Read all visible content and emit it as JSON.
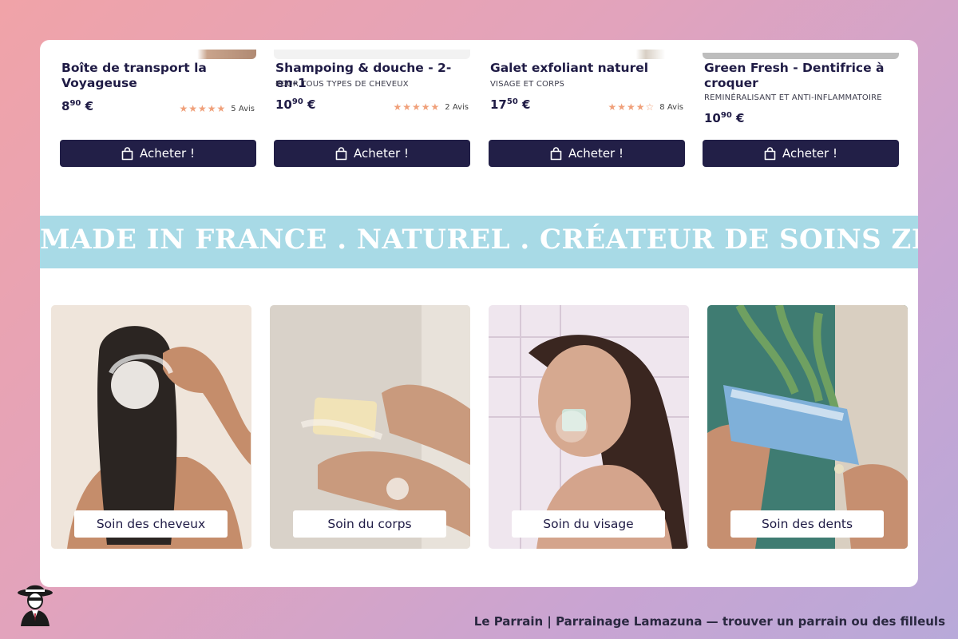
{
  "products": [
    {
      "name": "Boîte de transport la Voyageuse",
      "subtitle": "",
      "price_main": "8",
      "price_cents": "90",
      "price_currency": "€",
      "stars": "★★★★★",
      "reviews": "5 Avis"
    },
    {
      "name": "Shampoing & douche - 2-en-1",
      "subtitle": "POUR TOUS TYPES DE CHEVEUX",
      "price_main": "10",
      "price_cents": "90",
      "price_currency": "€",
      "stars": "★★★★★",
      "reviews": "2 Avis"
    },
    {
      "name": "Galet exfoliant naturel",
      "subtitle": "VISAGE ET CORPS",
      "price_main": "17",
      "price_cents": "50",
      "price_currency": "€",
      "stars": "★★★★☆",
      "reviews": "8 Avis"
    },
    {
      "name": "Green Fresh - Dentifrice à croquer",
      "subtitle": "REMINÉRALISANT ET ANTI-INFLAMMATOIRE",
      "price_main": "10",
      "price_cents": "90",
      "price_currency": "€",
      "stars": "",
      "reviews": ""
    }
  ],
  "buy_label": "Acheter !",
  "banner": {
    "text": "MADE IN FRANCE . NATUREL . CRÉATEUR DE SOINS ZÉRO DÉC"
  },
  "categories": [
    {
      "label": "Soin des cheveux"
    },
    {
      "label": "Soin du corps"
    },
    {
      "label": "Soin du visage"
    },
    {
      "label": "Soin des dents"
    }
  ],
  "footer": {
    "text": "Le Parrain | Parrainage Lamazuna — trouver un parrain ou des filleuls"
  },
  "colors": {
    "navy": "#221f47",
    "banner": "#a8dae6",
    "star": "#f0a07a"
  },
  "icons": {
    "buy": "shopping-bag-icon",
    "logo": "godfather-logo-icon"
  }
}
